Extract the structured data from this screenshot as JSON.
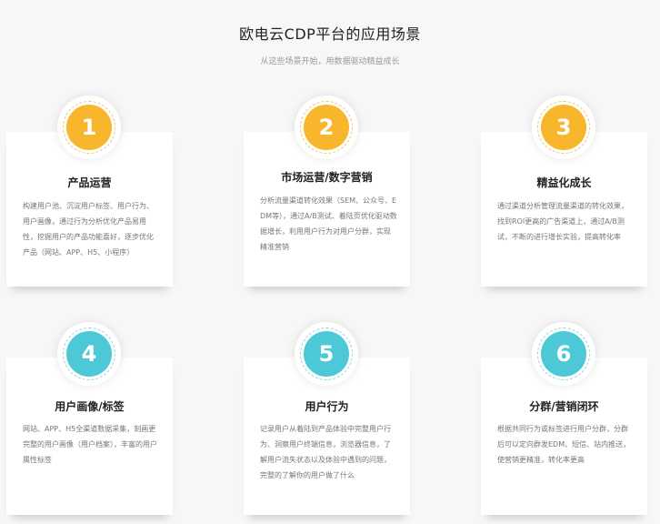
{
  "header": {
    "title": "欧电云CDP平台的应用场景",
    "subtitle": "从这些场景开始，用数据驱动精益成长"
  },
  "colors": {
    "amber": "#f8b62d",
    "teal": "#4dc8d6"
  },
  "cards": [
    {
      "number": "1",
      "title": "产品运营",
      "desc": "构建用户池、沉淀用户标签、用户行为、用户画像，通过行为分析优化产品易用性，挖掘用户的产品功能喜好，逐步优化产品（网站、APP、H5、小程序）"
    },
    {
      "number": "2",
      "title": "市场运营/数字营销",
      "desc": "分析流量渠道转化效果（SEM、公众号、EDM等），通过A/B测试、着陆页优化驱动数据增长，利用用户行为对用户分群，实现精准营销"
    },
    {
      "number": "3",
      "title": "精益化成长",
      "desc": "通过渠道分析管理流量渠道的转化效果，找到ROI更高的广告渠道上，通过A/B测试，不断的进行增长实验，提高转化率"
    },
    {
      "number": "4",
      "title": "用户画像/标签",
      "desc": "网站、APP、H5全渠道数据采集，刻画更完整的用户画像（用户档案），丰富的用户属性标签"
    },
    {
      "number": "5",
      "title": "用户行为",
      "desc": "记录用户从着陆到产品体验中完整用户行为、洞察用户终端信息，浏览器信息，了解用户流失状态以及体验中遇到的问题，完整的了解你的用户做了什么"
    },
    {
      "number": "6",
      "title": "分群/营销闭环",
      "desc": "根据共同行为或标签进行用户分群，分群后可以定向群发EDM、短信、站内推送，使营销更精准，转化率更高"
    }
  ]
}
